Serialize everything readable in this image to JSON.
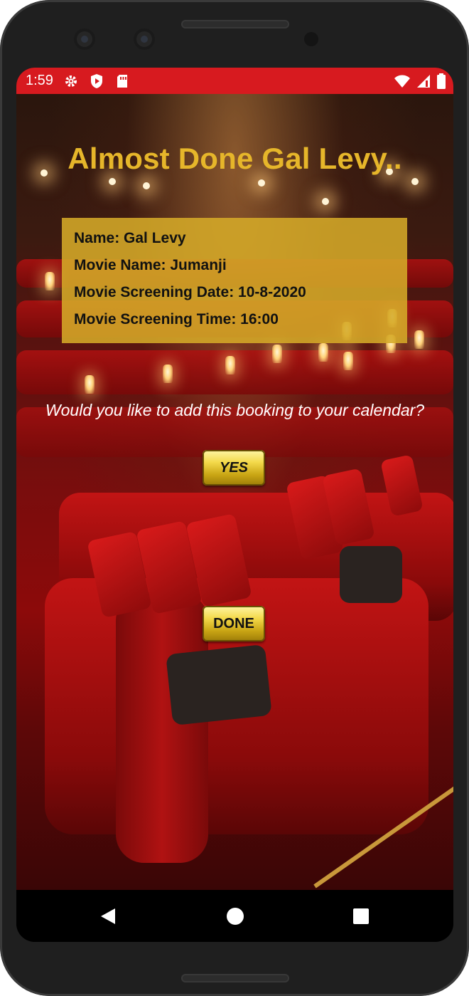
{
  "status_bar": {
    "time": "1:59",
    "left_icons": [
      "settings-icon",
      "shield-play-icon",
      "sd-card-icon"
    ],
    "right_icons": [
      "wifi-icon",
      "signal-icon",
      "battery-icon"
    ],
    "color": "#d71a1f"
  },
  "page": {
    "title": "Almost Done Gal Levy..",
    "title_color": "#e6b62a",
    "details": {
      "name": "Name: Gal Levy",
      "movie_name": "Movie Name: Jumanji",
      "screening_date": "Movie Screening Date: 10-8-2020",
      "screening_time": "Movie Screening Time: 16:00"
    },
    "question": "Would you like to add this booking to your calendar?",
    "yes_label": "YES",
    "done_label": "DONE"
  },
  "nav_bar": {
    "buttons": [
      "back-icon",
      "home-icon",
      "recents-icon"
    ]
  }
}
